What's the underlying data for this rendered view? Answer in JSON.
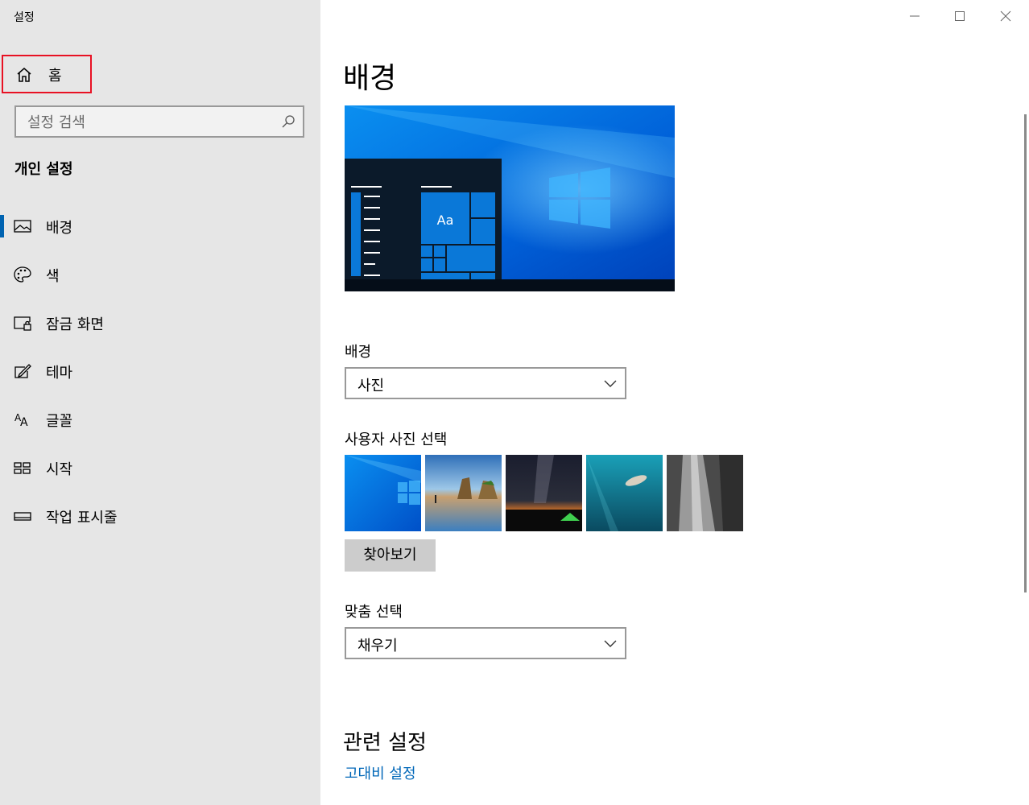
{
  "window": {
    "title": "설정"
  },
  "sidebar": {
    "home_label": "홈",
    "search_placeholder": "설정 검색",
    "section_title": "개인 설정",
    "items": [
      {
        "label": "배경",
        "icon": "picture-icon",
        "selected": true
      },
      {
        "label": "색",
        "icon": "palette-icon",
        "selected": false
      },
      {
        "label": "잠금 화면",
        "icon": "lock-screen-icon",
        "selected": false
      },
      {
        "label": "테마",
        "icon": "theme-brush-icon",
        "selected": false
      },
      {
        "label": "글꼴",
        "icon": "font-icon",
        "selected": false
      },
      {
        "label": "시작",
        "icon": "start-icon",
        "selected": false
      },
      {
        "label": "작업 표시줄",
        "icon": "taskbar-icon",
        "selected": false
      }
    ]
  },
  "main": {
    "page_title": "배경",
    "preview_tile_text": "Aa",
    "background_label": "배경",
    "background_value": "사진",
    "choose_picture_label": "사용자 사진 선택",
    "browse_label": "찾아보기",
    "fit_label": "맞춤 선택",
    "fit_value": "채우기",
    "related_title": "관련 설정",
    "related_links": [
      "고대비 설정"
    ]
  },
  "colors": {
    "accent": "#0063b1",
    "link": "#0067b8",
    "highlight_box": "#e81123",
    "sidebar_bg": "#e6e6e6"
  }
}
